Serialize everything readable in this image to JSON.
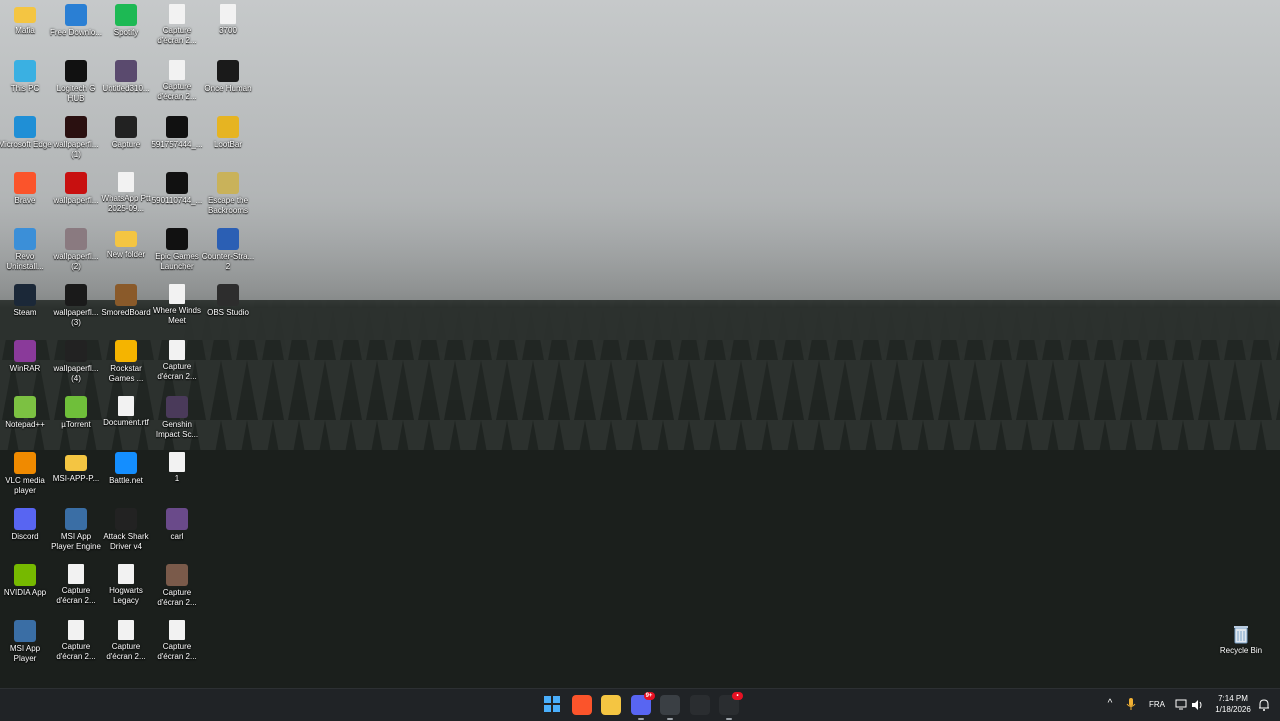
{
  "desktop": {
    "icons": [
      {
        "label": "Mafia",
        "icon": "folder-icon",
        "color": "#f4c542"
      },
      {
        "label": "Free Downlo...",
        "icon": "download-manager-icon",
        "color": "#2a7fd4"
      },
      {
        "label": "Spotify",
        "icon": "spotify-icon",
        "color": "#1db954"
      },
      {
        "label": "Capture d'écran 2...",
        "icon": "screenshot-file-icon",
        "color": "#f2f2f2"
      },
      {
        "label": "3700",
        "icon": "text-file-icon",
        "color": "#f2f2f2"
      },
      {
        "label": "This PC",
        "icon": "monitor-icon",
        "color": "#3ab0e2"
      },
      {
        "label": "Logitech G HUB",
        "icon": "logitech-icon",
        "color": "#111111"
      },
      {
        "label": "Untitled310...",
        "icon": "image-file-icon",
        "color": "#5a4a6e"
      },
      {
        "label": "Capture d'écran 2...",
        "icon": "screenshot-file-icon",
        "color": "#f2f2f2"
      },
      {
        "label": "Once Human",
        "icon": "once-human-icon",
        "color": "#1a1a1a"
      },
      {
        "label": "Microsoft Edge",
        "icon": "edge-icon",
        "color": "#1f8fd6"
      },
      {
        "label": "wallpaperfl... (1)",
        "icon": "image-file-icon",
        "color": "#2a1010"
      },
      {
        "label": "Capture",
        "icon": "phone-image-icon",
        "color": "#222222"
      },
      {
        "label": "591757444_...",
        "icon": "phone-image-icon",
        "color": "#111111"
      },
      {
        "label": "LootBar",
        "icon": "lootbar-icon",
        "color": "#e6b422"
      },
      {
        "label": "Brave",
        "icon": "brave-icon",
        "color": "#fb542b"
      },
      {
        "label": "wallpaperfl...",
        "icon": "image-file-icon",
        "color": "#c81010"
      },
      {
        "label": "WhatsApp Ptt 2025-09...",
        "icon": "audio-file-icon",
        "color": "#f2f2f2"
      },
      {
        "label": "590110744_...",
        "icon": "phone-image-icon",
        "color": "#111111"
      },
      {
        "label": "Escape the Backrooms",
        "icon": "backrooms-icon",
        "color": "#c9b25a"
      },
      {
        "label": "Revo Uninstall...",
        "icon": "revo-icon",
        "color": "#3b8fd8"
      },
      {
        "label": "wallpaperfl... (2)",
        "icon": "image-file-icon",
        "color": "#8a7a80"
      },
      {
        "label": "New folder",
        "icon": "folder-icon",
        "color": "#f4c542"
      },
      {
        "label": "Epic Games Launcher",
        "icon": "epic-icon",
        "color": "#111111"
      },
      {
        "label": "Counter-Stra... 2",
        "icon": "counter-strike-icon",
        "color": "#2b5fb4"
      },
      {
        "label": "Steam",
        "icon": "steam-icon",
        "color": "#1b2838"
      },
      {
        "label": "wallpaperfl... (3)",
        "icon": "image-file-icon",
        "color": "#1a1a1a"
      },
      {
        "label": "SmoredBoard",
        "icon": "smoredboard-icon",
        "color": "#8a5a2a"
      },
      {
        "label": "Where Winds Meet",
        "icon": "file-icon",
        "color": "#f2f2f2"
      },
      {
        "label": "OBS Studio",
        "icon": "obs-icon",
        "color": "#2d2d2d"
      },
      {
        "label": "WinRAR",
        "icon": "winrar-icon",
        "color": "#8a3a9a"
      },
      {
        "label": "wallpaperfl... (4)",
        "icon": "image-file-icon",
        "color": "#222222"
      },
      {
        "label": "Rockstar Games ...",
        "icon": "rockstar-icon",
        "color": "#f5b400"
      },
      {
        "label": "Capture d'écran 2...",
        "icon": "screenshot-file-icon",
        "color": "#f2f2f2"
      },
      {
        "label": "",
        "icon": "",
        "color": ""
      },
      {
        "label": "Notepad++",
        "icon": "notepadpp-icon",
        "color": "#7cc142"
      },
      {
        "label": "µTorrent",
        "icon": "utorrent-icon",
        "color": "#6fbf3a"
      },
      {
        "label": "Document.rtf",
        "icon": "document-icon",
        "color": "#f2f2f2"
      },
      {
        "label": "Genshin Impact Sc...",
        "icon": "genshin-icon",
        "color": "#4a3a5a"
      },
      {
        "label": "",
        "icon": "",
        "color": ""
      },
      {
        "label": "VLC media player",
        "icon": "vlc-icon",
        "color": "#f08a00"
      },
      {
        "label": "MSI-APP-P...",
        "icon": "folder-icon",
        "color": "#f4c542"
      },
      {
        "label": "Battle.net",
        "icon": "battlenet-icon",
        "color": "#148eff"
      },
      {
        "label": "1",
        "icon": "screenshot-file-icon",
        "color": "#f2f2f2"
      },
      {
        "label": "",
        "icon": "",
        "color": ""
      },
      {
        "label": "Discord",
        "icon": "discord-icon",
        "color": "#5865f2"
      },
      {
        "label": "MSI App Player Engine",
        "icon": "msi-app-icon",
        "color": "#3a6ea5"
      },
      {
        "label": "Attack Shark Driver v4",
        "icon": "attack-shark-icon",
        "color": "#222222"
      },
      {
        "label": "carl",
        "icon": "image-file-icon",
        "color": "#6a4a8a"
      },
      {
        "label": "",
        "icon": "",
        "color": ""
      },
      {
        "label": "NVIDIA App",
        "icon": "nvidia-icon",
        "color": "#76b900"
      },
      {
        "label": "Capture d'écran 2...",
        "icon": "screenshot-file-icon",
        "color": "#f2f2f2"
      },
      {
        "label": "Hogwarts Legacy",
        "icon": "file-icon",
        "color": "#f2f2f2"
      },
      {
        "label": "Capture d'écran 2...",
        "icon": "image-file-icon",
        "color": "#7a5a4a"
      },
      {
        "label": "",
        "icon": "",
        "color": ""
      },
      {
        "label": "MSI App Player",
        "icon": "msi-app-icon",
        "color": "#3a6ea5"
      },
      {
        "label": "Capture d'écran 2...",
        "icon": "document-icon",
        "color": "#f2f2f2"
      },
      {
        "label": "Capture d'écran 2...",
        "icon": "screenshot-file-icon",
        "color": "#f2f2f2"
      },
      {
        "label": "Capture d'écran 2...",
        "icon": "screenshot-file-icon",
        "color": "#f2f2f2"
      },
      {
        "label": "",
        "icon": "",
        "color": ""
      }
    ],
    "recycle_bin": {
      "label": "Recycle Bin",
      "icon": "recycle-bin-icon"
    }
  },
  "taskbar": {
    "apps": [
      {
        "name": "start-button",
        "icon": "windows-start-icon",
        "color": "#3aa0f5",
        "badge": "",
        "active": false
      },
      {
        "name": "taskbar-brave",
        "icon": "brave-icon",
        "color": "#fb542b",
        "badge": "",
        "active": false
      },
      {
        "name": "taskbar-file-explorer",
        "icon": "folder-icon",
        "color": "#f4c542",
        "badge": "",
        "active": false
      },
      {
        "name": "taskbar-discord",
        "icon": "discord-icon",
        "color": "#5865f2",
        "badge": "9+",
        "active": true
      },
      {
        "name": "taskbar-terminal",
        "icon": "terminal-icon",
        "color": "#3a3f44",
        "badge": "",
        "active": true
      },
      {
        "name": "taskbar-settings",
        "icon": "gear-icon",
        "color": "#2a2d30",
        "badge": "",
        "active": false
      },
      {
        "name": "taskbar-app",
        "icon": "circle-app-icon",
        "color": "#2a2d30",
        "badge": "•",
        "active": true
      }
    ],
    "tray": {
      "language": "FRA",
      "time": "7:14 PM",
      "date": "1/18/2026"
    }
  }
}
